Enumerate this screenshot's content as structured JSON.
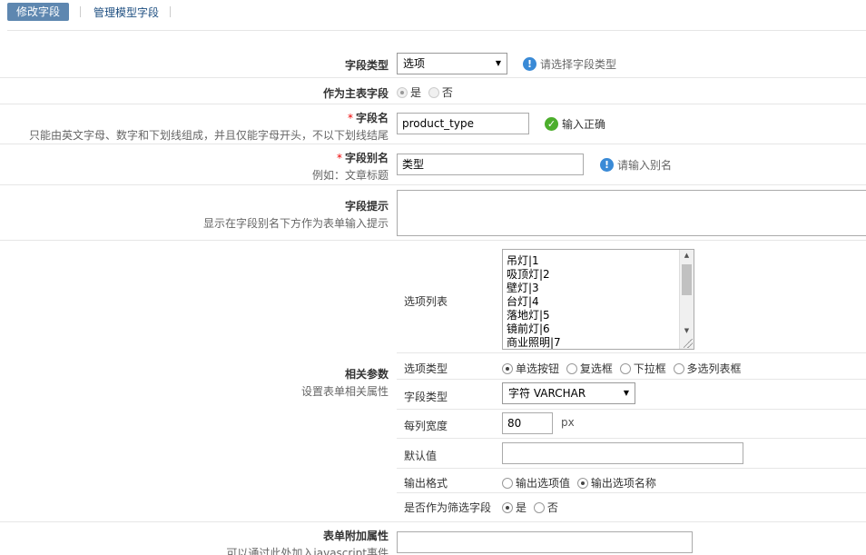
{
  "tabs": {
    "active": "修改字段",
    "manage": "管理模型字段"
  },
  "field_type": {
    "label": "字段类型",
    "value": "选项",
    "tip": "请选择字段类型"
  },
  "main_field": {
    "label": "作为主表字段",
    "yes": "是",
    "no": "否"
  },
  "field_name": {
    "label": "字段名",
    "hint": "只能由英文字母、数字和下划线组成，并且仅能字母开头，不以下划线结尾",
    "value": "product_type",
    "tip": "输入正确"
  },
  "alias": {
    "label": "字段别名",
    "hint": "例如：文章标题",
    "value": "类型",
    "tip": "请输入别名"
  },
  "prompt": {
    "label": "字段提示",
    "hint": "显示在字段别名下方作为表单输入提示",
    "value": ""
  },
  "params": {
    "label": "相关参数",
    "hint": "设置表单相关属性",
    "options_list": {
      "label": "选项列表",
      "lines": [
        "吊灯|1",
        "吸顶灯|2",
        "壁灯|3",
        "台灯|4",
        "落地灯|5",
        "镜前灯|6",
        "商业照明|7"
      ]
    },
    "option_type": {
      "label": "选项类型",
      "options": [
        "单选按钮",
        "复选框",
        "下拉框",
        "多选列表框"
      ],
      "selected": "单选按钮"
    },
    "db_type": {
      "label": "字段类型",
      "value": "字符 VARCHAR"
    },
    "width": {
      "label": "每列宽度",
      "value": "80",
      "unit": "px"
    },
    "default": {
      "label": "默认值",
      "value": ""
    },
    "output": {
      "label": "输出格式",
      "options": [
        "输出选项值",
        "输出选项名称"
      ],
      "selected": "输出选项名称"
    },
    "filter": {
      "label": "是否作为筛选字段",
      "yes": "是",
      "no": "否",
      "selected": "是"
    }
  },
  "extra": {
    "label": "表单附加属性",
    "hint": "可以通过此处加入javascript事件",
    "value": ""
  },
  "icons": {
    "info": "info-icon",
    "ok": "check-icon"
  },
  "colors": {
    "tab_active": "#5e87b0",
    "link": "#1d4e80",
    "required": "#e00000",
    "info": "#3a8ad6",
    "ok": "#4cae2c"
  }
}
